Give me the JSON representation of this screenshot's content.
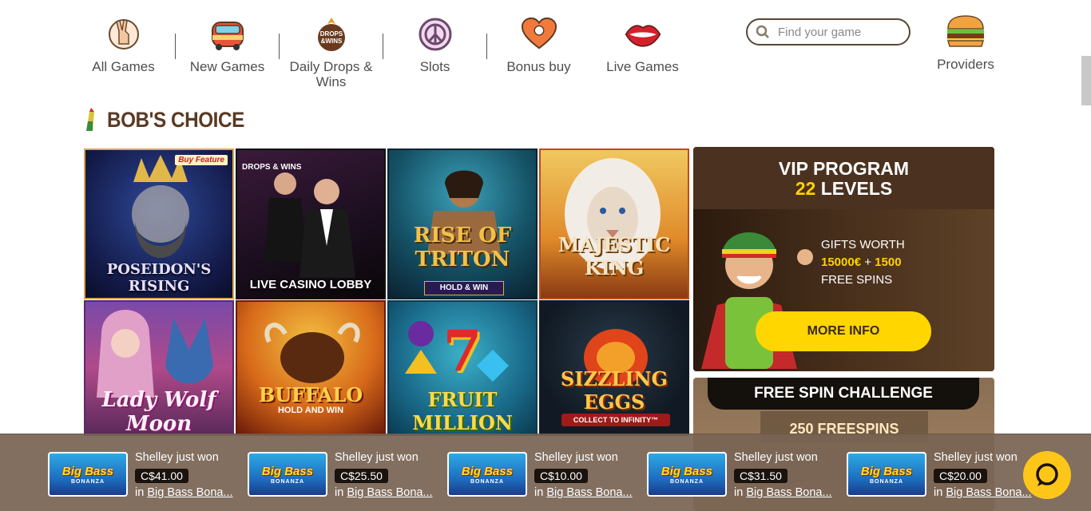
{
  "nav": {
    "items": [
      {
        "label": "All Games",
        "icon": "peace-hand-icon"
      },
      {
        "label": "New Games",
        "icon": "van-icon"
      },
      {
        "label": "Daily Drops & Wins",
        "icon": "drops-wins-icon"
      },
      {
        "label": "Slots",
        "icon": "peace-symbol-icon"
      },
      {
        "label": "Bonus buy",
        "icon": "heart-icon"
      },
      {
        "label": "Live Games",
        "icon": "lips-icon"
      }
    ],
    "search_placeholder": "Find your game",
    "providers_label": "Providers"
  },
  "section": {
    "title": "BOB'S CHOICE"
  },
  "games": [
    {
      "name": "POSEIDON'S RISING",
      "badge": "Buy Feature"
    },
    {
      "name": "LIVE CASINO LOBBY",
      "badge": "DROPS & WINS"
    },
    {
      "name": "RISE OF TRITON",
      "sub": "HOLD & WIN"
    },
    {
      "name": "MAJESTIC KING"
    },
    {
      "name": "Lady Wolf Moon"
    },
    {
      "name": "BUFFALO",
      "sub": "HOLD AND WIN"
    },
    {
      "name": "FRUIT MILLION",
      "sub": "7"
    },
    {
      "name": "SIZZLING EGGS",
      "sub": "COLLECT TO INFINITY™"
    }
  ],
  "vip": {
    "title_line1": "VIP PROGRAM",
    "levels_number": "22",
    "levels_word": "LEVELS",
    "gifts_line1": "GIFTS WORTH",
    "gifts_amount": "15000€",
    "gifts_plus": "+",
    "gifts_spins": "1500",
    "gifts_line3": "FREE SPINS",
    "button": "MORE INFO"
  },
  "free_spin": {
    "title": "FREE SPIN CHALLENGE",
    "sub": "250 FREESPINS"
  },
  "ticker": [
    {
      "who": "Shelley just won",
      "amount": "C$41.00",
      "prefix": "in",
      "game": "Big Bass Bona..."
    },
    {
      "who": "Shelley just won",
      "amount": "C$25.50",
      "prefix": "in",
      "game": "Big Bass Bona..."
    },
    {
      "who": "Shelley just won",
      "amount": "C$10.00",
      "prefix": "in",
      "game": "Big Bass Bona..."
    },
    {
      "who": "Shelley just won",
      "amount": "C$31.50",
      "prefix": "in",
      "game": "Big Bass Bona..."
    },
    {
      "who": "Shelley just won",
      "amount": "C$20.00",
      "prefix": "in",
      "game": "Big Bass Bona..."
    }
  ],
  "ticker_thumb": {
    "line1": "Big Bass",
    "line2": "BONANZA"
  },
  "colors": {
    "brand_brown": "#5a3a22",
    "accent_yellow": "#ffd600",
    "vip_bg": "#3a2616"
  }
}
